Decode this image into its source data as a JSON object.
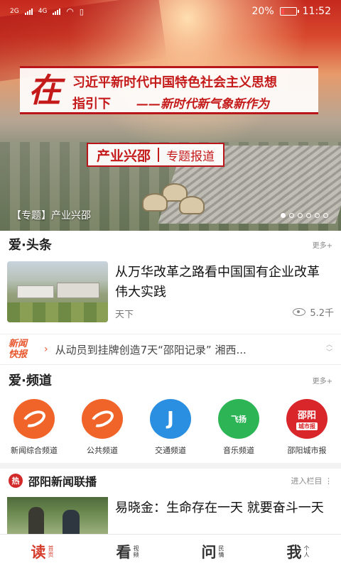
{
  "status_bar": {
    "net1": "2G",
    "net2": "4G",
    "battery": "20%",
    "time": "11:52"
  },
  "banner": {
    "slogan_big": "在",
    "slogan_line1": "习近平新时代中国特色社会主义思想",
    "slogan_line2": "指引下",
    "slogan_line3": "——新时代新气象新作为",
    "topic_title": "产业兴邵",
    "topic_sub": "专题报道",
    "caption": "【专题】产业兴邵",
    "dots_total": 6,
    "dots_active": 0
  },
  "headline": {
    "title": "爱·头条",
    "more": "更多+",
    "article": {
      "title": "从万华改革之路看中国国有企业改革伟大实践",
      "source": "天下",
      "views": "5.2千"
    }
  },
  "ticker": {
    "logo_line1": "新闻",
    "logo_line2": "快报",
    "text": "从动员到挂牌创造7天“邵阳记录” 湘西..."
  },
  "channels": {
    "title": "爱·频道",
    "more": "更多+",
    "items": [
      {
        "label": "新闻综合频道",
        "icon": "swirl-icon",
        "color": "#f0642a"
      },
      {
        "label": "公共频道",
        "icon": "swirl-icon",
        "color": "#f0642a"
      },
      {
        "label": "交通频道",
        "icon": "wave-icon",
        "color": "#2a8fe0",
        "badge": ""
      },
      {
        "label": "音乐频道",
        "icon": "music-icon",
        "color": "#2db555",
        "badge": "飞扬"
      },
      {
        "label": "邵阳城市报",
        "icon": "newspaper-icon",
        "color": "#d8262a",
        "badge": "邵阳"
      }
    ]
  },
  "broadcast": {
    "hot": "热",
    "title": "邵阳新闻联播",
    "more": "进入栏目",
    "article": {
      "title": "易晓金：生命存在一天 就要奋斗一天"
    }
  },
  "tabbar": {
    "items": [
      {
        "big": "读",
        "small": "首页"
      },
      {
        "big": "看",
        "small": "视频"
      },
      {
        "big": "问",
        "small": "民情"
      },
      {
        "big": "我",
        "small": "个人"
      }
    ]
  }
}
